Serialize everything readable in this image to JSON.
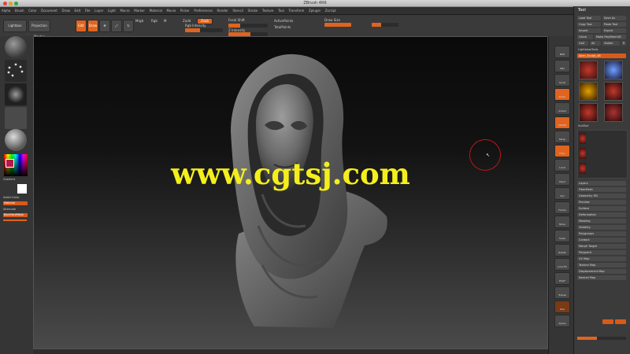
{
  "app": {
    "title": "ZBrush 4R6"
  },
  "menu": [
    "Alpha",
    "Brush",
    "Color",
    "Document",
    "Draw",
    "Edit",
    "File",
    "Layer",
    "Light",
    "Macro",
    "Marker",
    "Material",
    "Movie",
    "Picker",
    "Preferences",
    "Render",
    "Stencil",
    "Stroke",
    "Texture",
    "Tool",
    "Transform",
    "Zplugin",
    "Zscript"
  ],
  "shelf": {
    "left_tools": [
      "Lightbox",
      "Projection Master",
      "Edit",
      "Draw"
    ],
    "mode_buttons": [
      "Mrgb",
      "Rgb",
      "M"
    ],
    "zadd": "Zadd",
    "zsub": "Zsub",
    "focal_shift": "Focal Shift",
    "z_intensity": "Z Intensity",
    "draw_size": "Draw Size",
    "rgb_intensity": "Rgb Intensity",
    "active_points": "ActivePoints",
    "total_points": "TotalPoints",
    "accent_color": "#e0641f"
  },
  "left_tray": {
    "gradient_label": "Gradient",
    "switch_color": "SwitchColor",
    "alternate": "Alternate",
    "orange_items": [
      "Material",
      "BackfaceMask"
    ]
  },
  "viewport": {
    "watermark": "www.cgtsj.com",
    "model": "hooded-alien-bust-sculpt",
    "colors": {
      "watermark": "#f4ef1c",
      "cursor_ring": "#b81818"
    }
  },
  "right_shelf": [
    "BPR",
    "SPix",
    "Scroll",
    "Zoom",
    "Actual",
    "AAHalf",
    "Persp",
    "Floor",
    "Local",
    "LSym",
    "Xyz",
    "Frame",
    "Move",
    "Scale",
    "Rotate",
    "Line Fill",
    "PolyF",
    "Transp",
    "Solo",
    "Xpose"
  ],
  "tool_panel": {
    "title": "Tool",
    "rows": [
      "Load Tool",
      "Save As",
      "Copy Tool",
      "Paste Tool",
      "Import",
      "Export",
      "Clone",
      "Make PolyMesh3D",
      "GoZ",
      "All",
      "Visible",
      "R"
    ],
    "lightbox_label": "Lightbox▸Tools",
    "current_tool": "Alien_Sculpt_48",
    "subtool_label": "SubTool",
    "sections": [
      "Layers",
      "FiberMesh",
      "Geometry HD",
      "Preview",
      "Surface",
      "Deformation",
      "Masking",
      "Visibility",
      "Polygroups",
      "Contact",
      "Morph Target",
      "Polypaint",
      "UV Map",
      "Texture Map",
      "Displacement Map",
      "Normal Map"
    ]
  }
}
